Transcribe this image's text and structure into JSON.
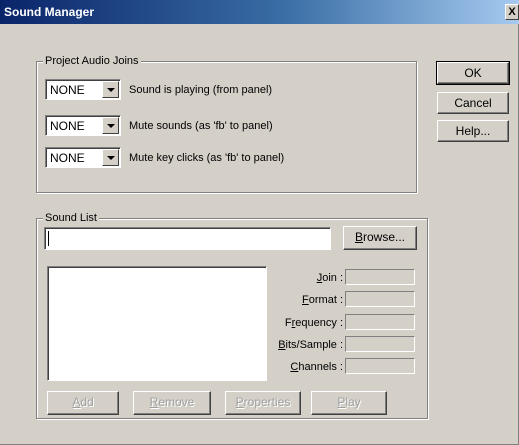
{
  "window": {
    "title": "Sound Manager",
    "close_glyph": "X"
  },
  "audio_joins": {
    "title": "Project Audio Joins",
    "rows": [
      {
        "value": "NONE",
        "label": "Sound is playing (from panel)"
      },
      {
        "value": "NONE",
        "label": "Mute sounds (as 'fb' to panel)"
      },
      {
        "value": "NONE",
        "label": "Mute key clicks (as 'fb' to panel)"
      }
    ]
  },
  "side_buttons": {
    "ok": "OK",
    "cancel": "Cancel",
    "help": "Help..."
  },
  "sound_list": {
    "title": "Sound List",
    "path_value": "",
    "browse": {
      "mnemonic": "B",
      "rest": "rowse..."
    },
    "fields": [
      {
        "mnemonic": "J",
        "rest": "oin :"
      },
      {
        "mnemonic": "F",
        "rest": "ormat :"
      },
      {
        "pre": "F",
        "mnemonic": "r",
        "rest": "equency :"
      },
      {
        "mnemonic": "B",
        "rest": "its/Sample :"
      },
      {
        "mnemonic": "C",
        "rest": "hannels :"
      }
    ],
    "actions": {
      "add": {
        "mnemonic": "A",
        "rest": "dd"
      },
      "remove": {
        "mnemonic": "R",
        "rest": "emove"
      },
      "properties": {
        "mnemonic": "P",
        "rest": "roperties"
      },
      "play": {
        "mnemonic": "P",
        "rest": "lay"
      }
    }
  }
}
